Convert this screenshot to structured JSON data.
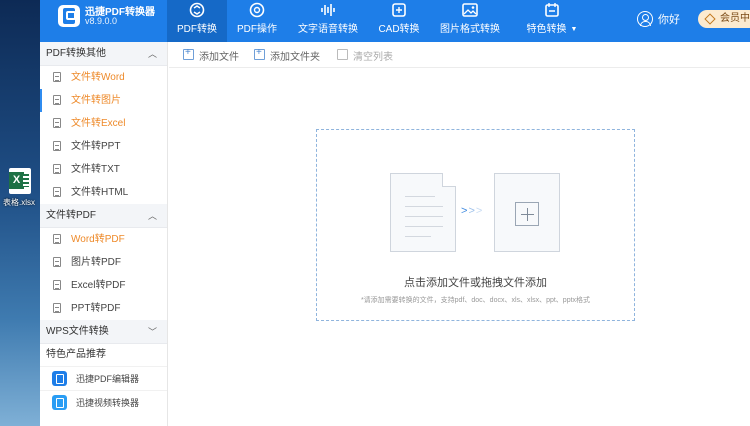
{
  "desktop": {
    "file_label": "表格.xlsx"
  },
  "app": {
    "title": "迅捷PDF转换器",
    "version": "v8.9.0.0"
  },
  "nav": [
    {
      "label": "PDF转换",
      "icon": "pdf-convert-icon",
      "active": true
    },
    {
      "label": "PDF操作",
      "icon": "pdf-operate-icon",
      "active": false
    },
    {
      "label": "文字语音转换",
      "icon": "voice-wave-icon",
      "active": false
    },
    {
      "label": "CAD转换",
      "icon": "cad-icon",
      "active": false
    },
    {
      "label": "图片格式转换",
      "icon": "image-icon",
      "active": false
    },
    {
      "label": "特色转换",
      "icon": "special-convert-icon",
      "active": false
    }
  ],
  "user": {
    "name": "你好",
    "vip_label": "会员中心"
  },
  "sidebar": {
    "sections": [
      {
        "title": "PDF转换其他",
        "items": [
          {
            "label": "文件转Word"
          },
          {
            "label": "文件转图片"
          },
          {
            "label": "文件转Excel"
          },
          {
            "label": "文件转PPT"
          },
          {
            "label": "文件转TXT"
          },
          {
            "label": "文件转HTML"
          }
        ]
      },
      {
        "title": "文件转PDF",
        "items": [
          {
            "label": "Word转PDF"
          },
          {
            "label": "图片转PDF"
          },
          {
            "label": "Excel转PDF"
          },
          {
            "label": "PPT转PDF"
          }
        ]
      },
      {
        "title": "WPS文件转换",
        "items": []
      }
    ],
    "featured": {
      "title": "特色产品推荐",
      "items": [
        {
          "label": "迅捷PDF编辑器"
        },
        {
          "label": "迅捷视频转换器"
        }
      ]
    }
  },
  "toolbar": {
    "add_file": "添加文件",
    "add_folder": "添加文件夹",
    "clear_list": "清空列表"
  },
  "dropzone": {
    "main_text": "点击添加文件或拖拽文件添加",
    "hint_text": "*请添加需要转换的文件，支持pdf、doc、docx、xls、xlsx、ppt、pptx格式"
  },
  "colors": {
    "brand": "#1e7ee8",
    "active_tab": "#1569c7",
    "orange_item": "#ee8a2a"
  }
}
